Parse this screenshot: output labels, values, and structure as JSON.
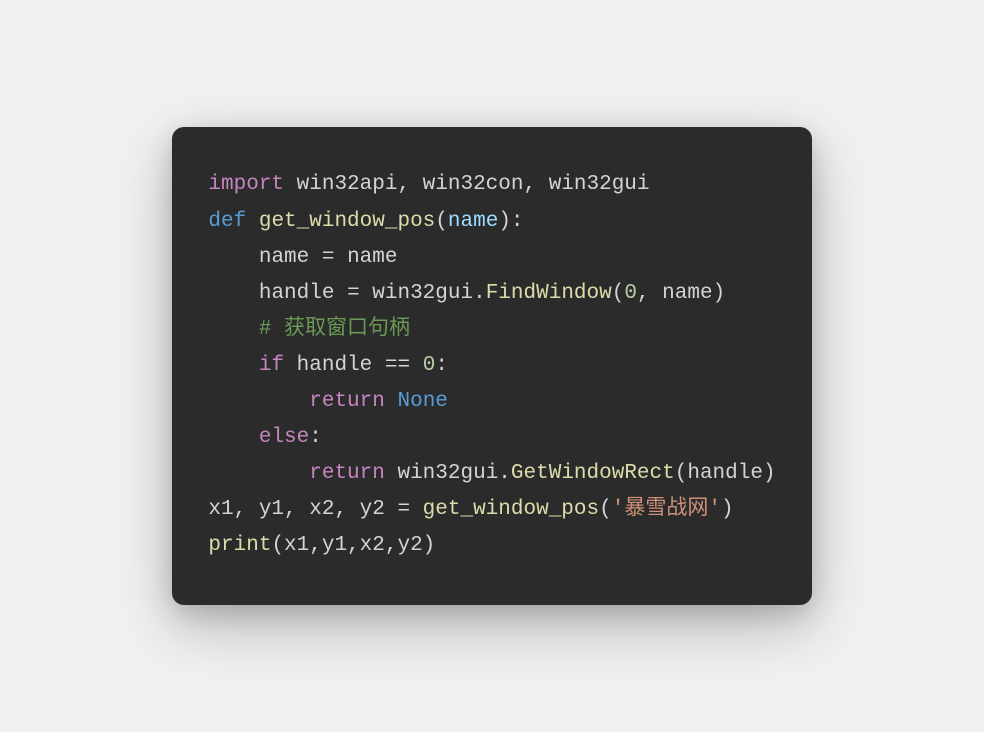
{
  "code": {
    "line1": {
      "import_kw": "import",
      "modules": " win32api, win32con, win32gui"
    },
    "line2": {
      "def_kw": "def",
      "space": " ",
      "fn_name": "get_window_pos",
      "open_paren": "(",
      "param": "name",
      "close": "):"
    },
    "line3": {
      "indent": "    ",
      "var": "name",
      "eq": " = ",
      "val": "name"
    },
    "line4": {
      "indent": "    ",
      "var": "handle",
      "eq": " = win32gui.",
      "call": "FindWindow",
      "open": "(",
      "arg1": "0",
      "comma": ", ",
      "arg2": "name",
      "close": ")"
    },
    "line5": {
      "indent": "    ",
      "comment": "# 获取窗口句柄"
    },
    "line6": {
      "indent": "    ",
      "if_kw": "if",
      "space": " ",
      "var": "handle",
      "op": " == ",
      "num": "0",
      "colon": ":"
    },
    "line7": {
      "indent": "        ",
      "return_kw": "return",
      "space": " ",
      "none_kw": "None"
    },
    "line8": {
      "indent": "    ",
      "else_kw": "else",
      "colon": ":"
    },
    "line9": {
      "indent": "        ",
      "return_kw": "return",
      "rest": " win32gui.",
      "call": "GetWindowRect",
      "open": "(",
      "arg": "handle",
      "close": ")"
    },
    "line10": {
      "vars": "x1, y1, x2, y2 = ",
      "call": "get_window_pos",
      "open": "(",
      "str": "'暴雪战网'",
      "close": ")"
    },
    "line11": {
      "call": "print",
      "open": "(",
      "args": "x1,y1,x2,y2",
      "close": ")"
    }
  }
}
